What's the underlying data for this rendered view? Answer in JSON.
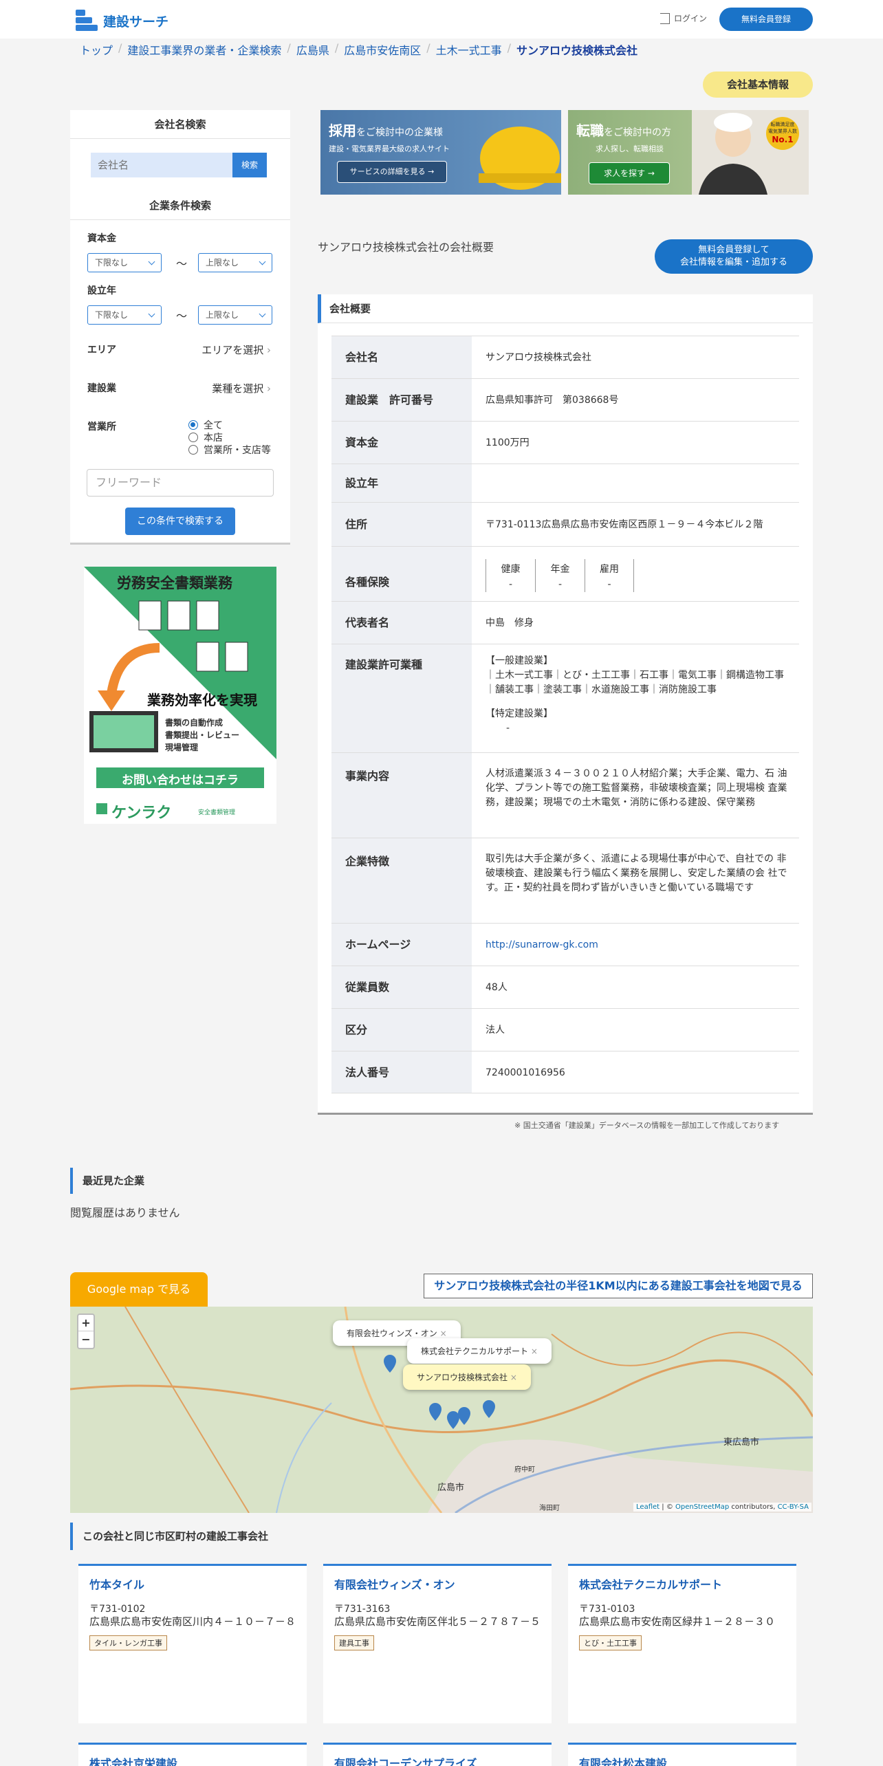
{
  "header": {
    "logo_text": "建設サーチ",
    "login_label": "ログイン",
    "register_label": "無料会員登録"
  },
  "breadcrumb": [
    "トップ",
    "建設工事業界の業者・企業検索",
    "広島県",
    "広島市安佐南区",
    "土木一式工事",
    "サンアロウ技検株式会社"
  ],
  "basic_info_badge": "会社基本情報",
  "sidebar": {
    "name_search_title": "会社名検索",
    "name_search_placeholder": "会社名",
    "name_search_button": "検索",
    "cond_title": "企業条件検索",
    "capital_label": "資本金",
    "capital_min": "下限なし",
    "capital_max": "上限なし",
    "tilde": "〜",
    "founded_label": "設立年",
    "founded_min": "下限なし",
    "founded_max": "上限なし",
    "area_label": "エリア",
    "area_pick": "エリアを選択",
    "industry_label": "建設業",
    "industry_pick": "業種を選択",
    "office_label": "営業所",
    "office_options": [
      "全て",
      "本店",
      "営業所・支店等"
    ],
    "freeword_placeholder": "フリーワード",
    "cond_button": "この条件で検索する"
  },
  "ad_side": {
    "title": "労務安全書類業務",
    "headline": "業務効率化を実現",
    "bullets": [
      "書類の自動作成",
      "書類提出・レビュー",
      "現場管理"
    ],
    "cta": "お問い合わせはコチラ",
    "brand": "ケンラク",
    "brand_sub": "安全書類管理"
  },
  "banner1": {
    "title_em": "採用",
    "title_rest": "をご検討中の企業様",
    "sub": "建設・電気業界最大級の求人サイト",
    "button": "サービスの詳細を見る →"
  },
  "banner2": {
    "title_em": "転職",
    "title_rest": "をご検討中の方",
    "sub": "求人探し、転職相談",
    "button": "求人を探す →",
    "badge_top": "転職満足度",
    "badge_mid": "電気業界人数",
    "badge_no": "No.1"
  },
  "overview_label": "サンアロウ技検株式会社の会社概要",
  "edit_button": [
    "無料会員登録して",
    "会社情報を編集・追加する"
  ],
  "card_title": "会社概要",
  "rows": [
    {
      "th": "会社名",
      "td": "サンアロウ技検株式会社"
    },
    {
      "th": "建設業　許可番号",
      "td": "広島県知事許可　第038668号"
    },
    {
      "th": "資本金",
      "td": "1100万円"
    },
    {
      "th": "設立年",
      "td": ""
    },
    {
      "th": "住所",
      "td": "〒731-0113広島県広島市安佐南区西原１－９－４今本ビル２階"
    },
    {
      "th": "各種保険",
      "td": ""
    },
    {
      "th": "代表者名",
      "td": "中島　修身"
    },
    {
      "th": "建設業許可業種",
      "td": ""
    },
    {
      "th": "事業内容",
      "td": "人材派遣業派３４－３００２１０人材紹介業；大手企業、電力、石 油化学、プラント等での施工監督業務，非破壊検査業；同上現場検 査業務，建設業；現場での土木電気・消防に係わる建設、保守業務"
    },
    {
      "th": "企業特徴",
      "td": "取引先は大手企業が多く、派遣による現場仕事が中心で、自社での 非破壊検査、建設業も行う幅広く業務を展開し、安定した業績の会 社です。正・契約社員を問わず皆がいきいきと働いている職場です"
    },
    {
      "th": "ホームページ",
      "td": "http://sunarrow-gk.com"
    },
    {
      "th": "従業員数",
      "td": "48人"
    },
    {
      "th": "区分",
      "td": "法人"
    },
    {
      "th": "法人番号",
      "td": "7240001016956"
    }
  ],
  "insurance": [
    {
      "name": "健康",
      "value": "-"
    },
    {
      "name": "年金",
      "value": "-"
    },
    {
      "name": "雇用",
      "value": "-"
    }
  ],
  "permit": {
    "general_label": "【一般建設業】",
    "general": "｜土木一式工事｜とび・土工工事｜石工事｜電気工事｜鋼構造物工事｜舗装工事｜塗装工事｜水道施設工事｜消防施設工事",
    "special_label": "【特定建設業】",
    "special": "-"
  },
  "source_note": "※ 国土交通省「建設業」データベースの情報を一部加工して作成しております",
  "recent": {
    "title": "最近見た企業",
    "empty": "閲覧履歴はありません"
  },
  "map": {
    "gmap_button": "Google map で見る",
    "radius_button": "サンアロウ技検株式会社の半径1KM以内にある建設工事会社を地図で見る",
    "zoom_in": "+",
    "zoom_out": "−",
    "popups": [
      "有限会社ウィンズ・オン",
      "株式会社テクニカルサポート",
      "サンアロウ技検株式会社"
    ],
    "place_labels": [
      "広島市",
      "東広島市",
      "府中町",
      "海田町"
    ],
    "attribution_leaflet": "Leaflet",
    "attribution_mid": " | © ",
    "attribution_osm": "OpenStreetMap",
    "attribution_contrib": " contributors, ",
    "attribution_cc": "CC-BY-SA"
  },
  "same_area": {
    "title": "この会社と同じ市区町村の建設工事会社",
    "companies": [
      {
        "name": "竹本タイル",
        "zip": "〒731-0102",
        "addr": "広島県広島市安佐南区川内４－１０－７－８",
        "tag": "タイル・レンガ工事"
      },
      {
        "name": "有限会社ウィンズ・オン",
        "zip": "〒731-3163",
        "addr": "広島県広島市安佐南区伴北５－２７８７－５",
        "tag": "建具工事"
      },
      {
        "name": "株式会社テクニカルサポート",
        "zip": "〒731-0103",
        "addr": "広島県広島市安佐南区緑井１－２８－３０",
        "tag": "とび・土工工事"
      },
      {
        "name": "株式会社京栄建設"
      },
      {
        "name": "有限会社コーデンサプライズ"
      },
      {
        "name": "有限会社松本建設"
      }
    ]
  },
  "colors": {
    "accent": "#1a73c8",
    "badge": "#f8e88a",
    "map_button": "#f7a900"
  }
}
